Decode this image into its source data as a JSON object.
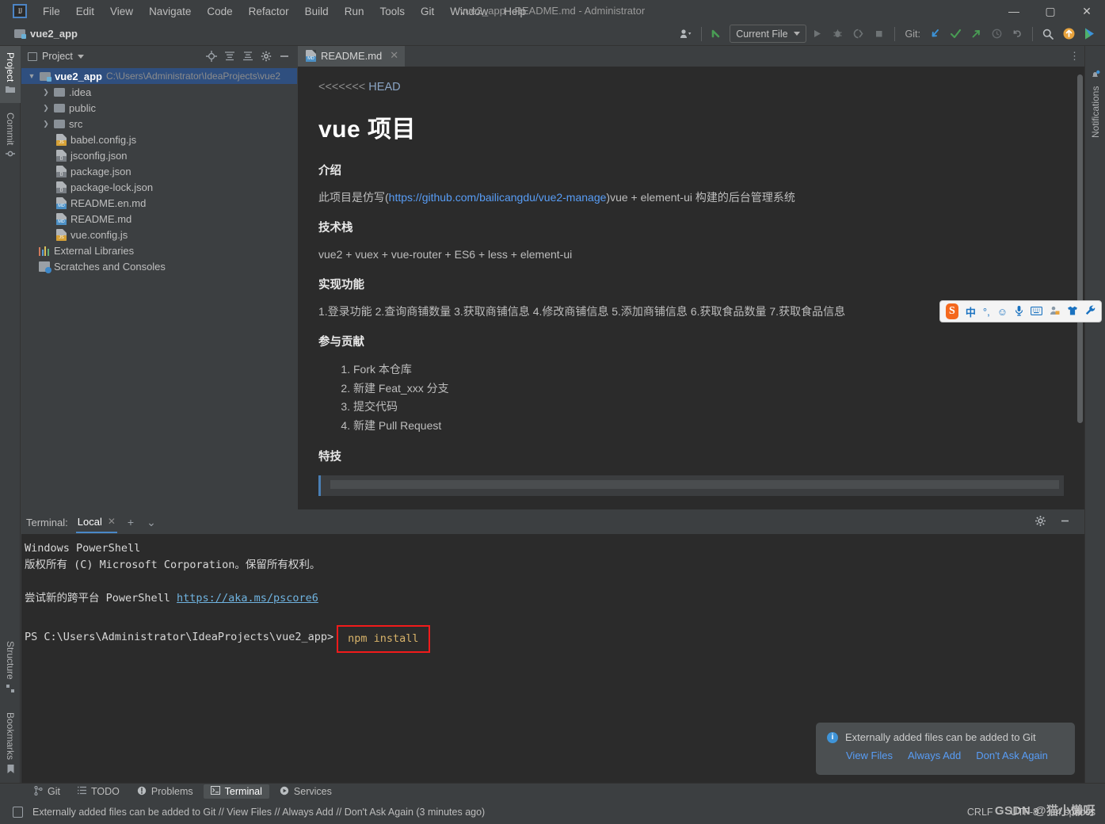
{
  "window": {
    "title": "vue2_app - README.md - Administrator",
    "minimize": "—",
    "maximize": "▢",
    "close": "✕"
  },
  "menubar": {
    "logo": "IJ",
    "items": [
      "File",
      "Edit",
      "View",
      "Navigate",
      "Code",
      "Refactor",
      "Build",
      "Run",
      "Tools",
      "Git",
      "Window",
      "Help"
    ]
  },
  "toolbar": {
    "project_name": "vue2_app",
    "run_config": "Current File",
    "git_label": "Git:",
    "icons": [
      "profile-dropdown-icon",
      "checkout-icon",
      "run-icon",
      "debug-icon",
      "coverage-icon",
      "stop-icon",
      "git-update-icon",
      "git-commit-icon",
      "git-push-icon",
      "git-history-icon",
      "git-rollback-icon",
      "search-everywhere-icon",
      "update-icon",
      "ide-feature-icon"
    ]
  },
  "left_strip": {
    "top": [
      {
        "label": "Project",
        "icon": "folder-icon",
        "active": true
      },
      {
        "label": "Commit",
        "icon": "commit-icon",
        "active": false
      }
    ],
    "bottom": [
      {
        "label": "Structure",
        "icon": "structure-icon"
      },
      {
        "label": "Bookmarks",
        "icon": "bookmark-icon"
      }
    ]
  },
  "right_strip": {
    "items": [
      {
        "label": "Notifications",
        "icon": "bell-icon"
      }
    ]
  },
  "project_panel": {
    "title": "Project",
    "actions": [
      "locate-icon",
      "expand-all-icon",
      "collapse-all-icon",
      "settings-icon",
      "hide-icon"
    ],
    "tree": [
      {
        "label": "vue2_app",
        "secondary": "C:\\Users\\Administrator\\IdeaProjects\\vue2",
        "kind": "project",
        "indent": 0,
        "arrow": "expanded",
        "selected": true
      },
      {
        "label": ".idea",
        "kind": "folder",
        "indent": 1,
        "arrow": "collapsed"
      },
      {
        "label": "public",
        "kind": "folder",
        "indent": 1,
        "arrow": "collapsed"
      },
      {
        "label": "src",
        "kind": "folder",
        "indent": 1,
        "arrow": "collapsed"
      },
      {
        "label": "babel.config.js",
        "kind": "js",
        "indent": 1,
        "arrow": "none"
      },
      {
        "label": "jsconfig.json",
        "kind": "json",
        "indent": 1,
        "arrow": "none"
      },
      {
        "label": "package.json",
        "kind": "json",
        "indent": 1,
        "arrow": "none"
      },
      {
        "label": "package-lock.json",
        "kind": "json",
        "indent": 1,
        "arrow": "none"
      },
      {
        "label": "README.en.md",
        "kind": "md",
        "indent": 1,
        "arrow": "none"
      },
      {
        "label": "README.md",
        "kind": "md",
        "indent": 1,
        "arrow": "none"
      },
      {
        "label": "vue.config.js",
        "kind": "js",
        "indent": 1,
        "arrow": "none"
      },
      {
        "label": "External Libraries",
        "kind": "lib",
        "indent": 0,
        "arrow": "none"
      },
      {
        "label": "Scratches and Consoles",
        "kind": "scratch",
        "indent": 0,
        "arrow": "none"
      }
    ]
  },
  "editor": {
    "tab": {
      "label": "README.md",
      "icon": "markdown-icon",
      "close": "✕"
    },
    "conflict_marker": {
      "chevrons": "<<<<<<<",
      "text": " HEAD"
    },
    "heading": "vue 项目",
    "sections": [
      {
        "heading": "介绍",
        "text_before": "此项目是仿写(",
        "link": "https://github.com/bailicangdu/vue2-manage",
        "text_after": ")vue + element-ui 构建的后台管理系统"
      },
      {
        "heading": "技术栈",
        "text": "vue2 + vuex + vue-router + ES6 + less + element-ui"
      },
      {
        "heading": "实现功能",
        "text": "1.登录功能 2.查询商铺数量 3.获取商铺信息 4.修改商铺信息 5.添加商铺信息 6.获取食品数量 7.获取食品信息"
      },
      {
        "heading": "参与贡献",
        "list": [
          "Fork 本仓库",
          "新建 Feat_xxx 分支",
          "提交代码",
          "新建 Pull Request"
        ]
      },
      {
        "heading": "特技"
      }
    ]
  },
  "terminal": {
    "label": "Terminal:",
    "tab": "Local",
    "tab_close": "✕",
    "add": "+",
    "dropdown": "⌄",
    "settings_icon": "gear-icon",
    "hide_icon": "minimize-icon",
    "lines": [
      "Windows PowerShell",
      "版权所有 (C) Microsoft Corporation。保留所有权利。",
      "",
      "",
      "尝试新的跨平台 PowerShell "
    ],
    "link": "https://aka.ms/pscore6",
    "prompt": "PS C:\\Users\\Administrator\\IdeaProjects\\vue2_app>",
    "command": "npm install",
    "highlight_color": "#f21b1b"
  },
  "balloon": {
    "icon": "info-icon",
    "message": "Externally added files can be added to Git",
    "actions": [
      "View Files",
      "Always Add",
      "Don't Ask Again"
    ]
  },
  "toolwindow_bar": {
    "items": [
      {
        "label": "Git",
        "icon": "git-branch-icon",
        "active": false
      },
      {
        "label": "TODO",
        "icon": "list-icon",
        "active": false
      },
      {
        "label": "Problems",
        "icon": "warning-icon",
        "active": false
      },
      {
        "label": "Terminal",
        "icon": "terminal-icon",
        "active": true
      },
      {
        "label": "Services",
        "icon": "play-circle-icon",
        "active": false
      }
    ]
  },
  "status_bar": {
    "icon": "event-log-icon",
    "message": "Externally added files can be added to Git // View Files // Always Add // Don't Ask Again (3 minutes ago)",
    "line_sep": "CRLF",
    "encoding": "UTF-8",
    "indent": "4 spaces",
    "watermark": "GSDN @猫小懒呀"
  },
  "ime": {
    "logo": "S",
    "items": [
      "中",
      "°,",
      "☺",
      "🎤",
      "⌨",
      "👤",
      "👕",
      "🔧"
    ]
  },
  "colors": {
    "accent_blue": "#589df6",
    "selection": "#2f4f7f",
    "panel_bg": "#3c3f41",
    "editor_bg": "#2b2b2b",
    "highlight_red": "#f21b1b",
    "tab_underline": "#4a88c7"
  }
}
